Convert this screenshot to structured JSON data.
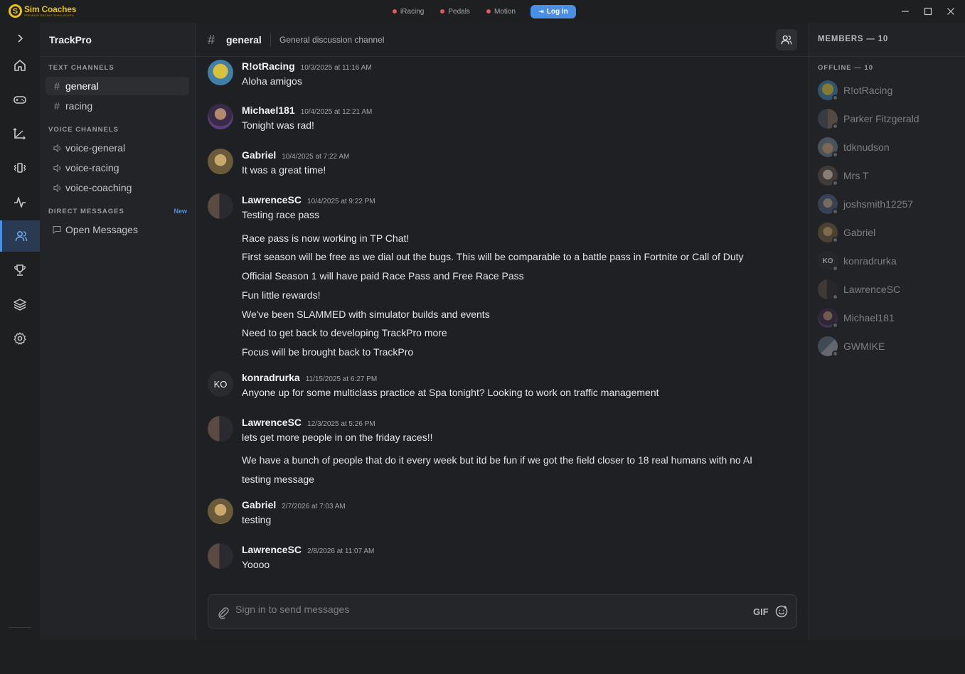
{
  "app": {
    "logo_mark": "S",
    "logo_title": "Sim Coaches",
    "logo_sub": "PREMIUM RACING SIMULATORS",
    "status": [
      {
        "label": "iRacing",
        "color": "#e2595b"
      },
      {
        "label": "Pedals",
        "color": "#e2595b"
      },
      {
        "label": "Motion",
        "color": "#e2595b"
      }
    ],
    "login_label": "Log In",
    "window_controls": [
      "minimize-icon",
      "maximize-icon",
      "close-icon"
    ]
  },
  "rail": {
    "items": [
      "chevron-right-icon",
      "home-icon",
      "gamepad-icon",
      "axes-icon",
      "vibration-icon",
      "activity-icon",
      "users-icon",
      "trophy-icon",
      "layers-icon",
      "gear-icon",
      "broadcast-icon"
    ],
    "active": "users-icon"
  },
  "sidebar": {
    "server_name": "TrackPro",
    "text_header": "TEXT CHANNELS",
    "text_channels": [
      "general",
      "racing"
    ],
    "voice_header": "VOICE CHANNELS",
    "voice_channels": [
      "voice-general",
      "voice-racing",
      "voice-coaching"
    ],
    "dm_header": "DIRECT MESSAGES",
    "dm_new": "New",
    "dm_open": "Open Messages"
  },
  "channel": {
    "hash": "#",
    "name": "general",
    "description": "General discussion channel"
  },
  "messages": [
    {
      "author": "R!otRacing",
      "timestamp": "10/3/2025 at 11:16 AM",
      "lines": [
        "Aloha amigos"
      ]
    },
    {
      "author": "Michael181",
      "timestamp": "10/4/2025 at 12:21 AM",
      "lines": [
        "Tonight was rad!"
      ]
    },
    {
      "author": "Gabriel",
      "timestamp": "10/4/2025 at 7:22 AM",
      "lines": [
        "It was a great time!"
      ]
    },
    {
      "author": "LawrenceSC",
      "timestamp": "10/4/2025 at 9:22 PM",
      "lines": [
        "Testing race pass",
        "Race pass is now working in TP Chat!",
        "First season will be free as we dial out the bugs. This will be comparable to a battle pass in Fortnite or Call of Duty",
        "Official Season 1 will have paid Race Pass and Free Race Pass",
        "Fun little rewards!",
        "We've been SLAMMED with simulator builds and events",
        "Need to get back to developing TrackPro more",
        "Focus will be brought back to TrackPro"
      ]
    },
    {
      "author": "konradrurka",
      "avatar_text": "KO",
      "timestamp": "11/15/2025 at 6:27 PM",
      "lines": [
        "Anyone up for some multiclass practice at Spa tonight? Looking to work on traffic management"
      ]
    },
    {
      "author": "LawrenceSC",
      "timestamp": "12/3/2025 at 5:26 PM",
      "lines": [
        "lets get more people in on the friday races!!",
        "We have a bunch of people that do it every week but itd be fun if we got the field closer to 18 real humans with no AI",
        "testing message"
      ]
    },
    {
      "author": "Gabriel",
      "timestamp": "2/7/2026 at 7:03 AM",
      "lines": [
        "testing"
      ]
    },
    {
      "author": "LawrenceSC",
      "timestamp": "2/8/2026 at 11:07 AM",
      "lines": [
        "Yoooo"
      ]
    }
  ],
  "composer": {
    "placeholder": "Sign in to send messages",
    "gif_label": "GIF"
  },
  "members": {
    "header": "MEMBERS — 10",
    "offline_header": "OFFLINE — 10",
    "list": [
      {
        "name": "R!otRacing"
      },
      {
        "name": "Parker Fitzgerald"
      },
      {
        "name": "tdknudson"
      },
      {
        "name": "Mrs T"
      },
      {
        "name": "joshsmith12257"
      },
      {
        "name": "Gabriel"
      },
      {
        "name": "konradrurka",
        "avatar_text": "KO"
      },
      {
        "name": "LawrenceSC"
      },
      {
        "name": "Michael181"
      },
      {
        "name": "GWMIKE"
      }
    ]
  }
}
